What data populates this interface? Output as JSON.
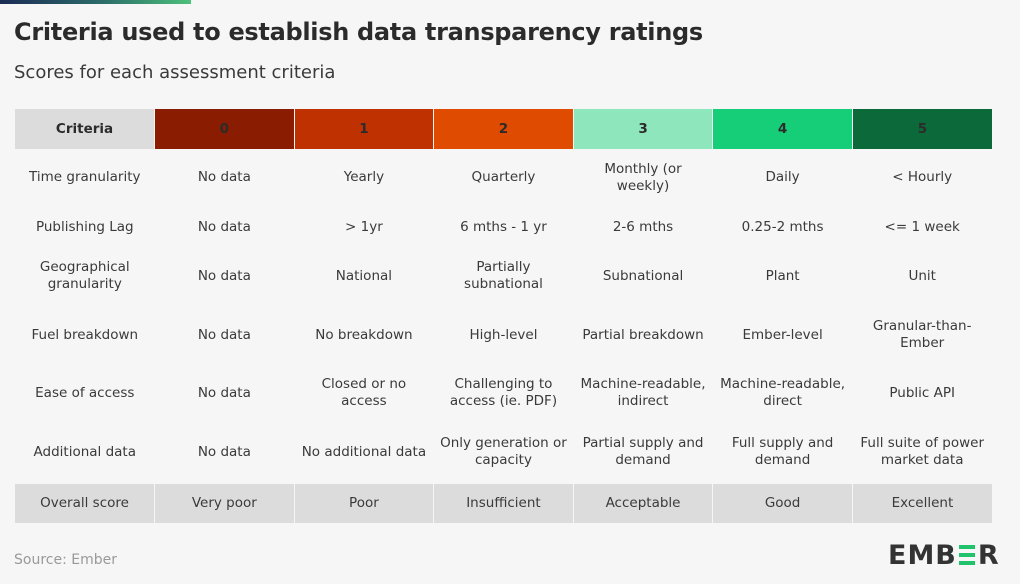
{
  "title": "Criteria used to establish data transparency ratings",
  "subtitle": "Scores for each assessment criteria",
  "table": {
    "header": [
      {
        "label": "Criteria",
        "color": "#dcdcdc"
      },
      {
        "label": "0",
        "color": "#8a1c02"
      },
      {
        "label": "1",
        "color": "#c03102"
      },
      {
        "label": "2",
        "color": "#e04b02"
      },
      {
        "label": "3",
        "color": "#8de6bc"
      },
      {
        "label": "4",
        "color": "#17ce78"
      },
      {
        "label": "5",
        "color": "#0c6a3a"
      }
    ],
    "rows": [
      {
        "criteria": "Time granularity",
        "cells": [
          "No data",
          "Yearly",
          "Quarterly",
          "Monthly (or weekly)",
          "Daily",
          "< Hourly"
        ]
      },
      {
        "criteria": "Publishing Lag",
        "cells": [
          "No data",
          "> 1yr",
          "6 mths - 1 yr",
          "2-6 mths",
          "0.25-2 mths",
          "<= 1 week"
        ]
      },
      {
        "criteria": "Geographical granularity",
        "cells": [
          "No data",
          "National",
          "Partially subnational",
          "Subnational",
          "Plant",
          "Unit"
        ]
      },
      {
        "criteria": "Fuel breakdown",
        "cells": [
          "No data",
          "No breakdown",
          "High-level",
          "Partial breakdown",
          "Ember-level",
          "Granular-than-Ember"
        ]
      },
      {
        "criteria": "Ease of access",
        "cells": [
          "No data",
          "Closed or no access",
          "Challenging to access (ie. PDF)",
          "Machine-readable, indirect",
          "Machine-readable, direct",
          "Public API"
        ]
      },
      {
        "criteria": "Additional data",
        "cells": [
          "No data",
          "No additional data",
          "Only generation or capacity",
          "Partial supply and demand",
          "Full supply and demand",
          "Full suite of power market data"
        ]
      }
    ],
    "overall": {
      "criteria": "Overall score",
      "cells": [
        "Very poor",
        "Poor",
        "Insufficient",
        "Acceptable",
        "Good",
        "Excellent"
      ]
    }
  },
  "source": "Source: Ember",
  "logo": {
    "left": "EMB",
    "right": "R",
    "accent": "#21c26c"
  }
}
